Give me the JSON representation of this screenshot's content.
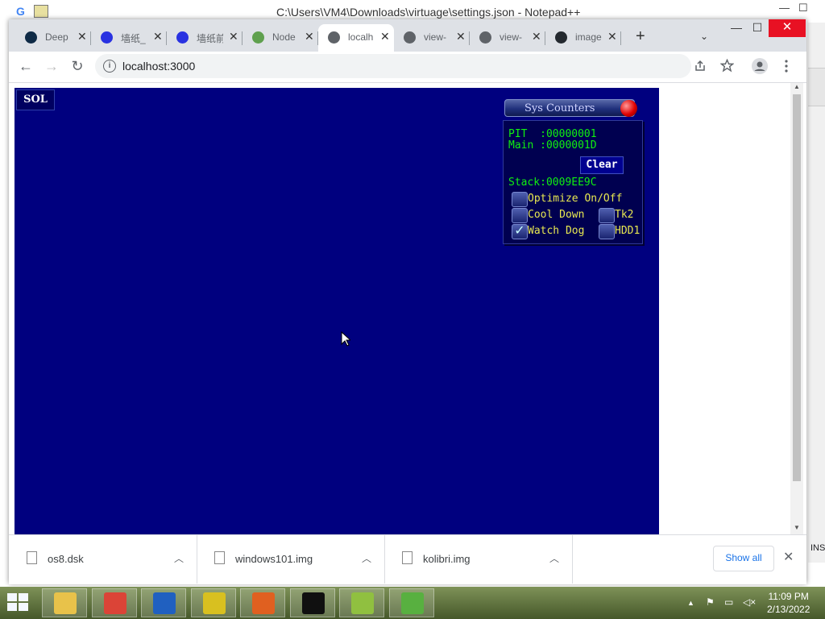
{
  "notepadpp": {
    "title": "C:\\Users\\VM4\\Downloads\\virtuage\\settings.json - Notepad++",
    "minimize": "—",
    "maximize": "☐",
    "ins_status": "INS",
    "g_logo": "G"
  },
  "browser": {
    "tabs": [
      {
        "label": "Deep",
        "icon": "deepl-icon",
        "color": "#0f2b46"
      },
      {
        "label": "墙纸_",
        "icon": "baidu-paw-icon",
        "color": "#2932e1"
      },
      {
        "label": "墙纸前",
        "icon": "baidu-paw-icon",
        "color": "#2932e1"
      },
      {
        "label": "Node",
        "icon": "nodejs-icon",
        "color": "#5fa04e"
      },
      {
        "label": "localh",
        "icon": "globe-icon",
        "color": "#5f6368",
        "active": true
      },
      {
        "label": "view-",
        "icon": "globe-icon",
        "color": "#5f6368"
      },
      {
        "label": "view-",
        "icon": "globe-icon",
        "color": "#5f6368"
      },
      {
        "label": "image",
        "icon": "github-icon",
        "color": "#24292f"
      }
    ],
    "tab_close": "✕",
    "new_tab": "+",
    "tab_search": "⌄",
    "window_min": "—",
    "window_max": "☐",
    "window_close": "✕",
    "nav": {
      "back": "←",
      "forward": "→",
      "reload": "↻"
    },
    "url": "localhost:3000",
    "toolbar_icons": [
      "share-icon",
      "bookmark-star-icon",
      "profile-icon",
      "kebab-menu-icon"
    ]
  },
  "page": {
    "background": "#00007f",
    "sol_button": "SOL",
    "sys_counters": {
      "title": "Sys Counters",
      "pit_line": "PIT  :00000001",
      "main_line": "Main :0000001D",
      "clear": "Clear",
      "stack_line": "Stack:0009EE9C",
      "optimize": "Optimize On/Off",
      "cool_down": "Cool Down",
      "tk2": "Tk2",
      "watch_dog": "Watch Dog",
      "hdd1": "HDD1",
      "checked": {
        "optimize": false,
        "cool_down": false,
        "tk2": false,
        "watch_dog": true,
        "hdd1": false
      }
    }
  },
  "downloads": {
    "items": [
      "os8.dsk",
      "windows101.img",
      "kolibri.img"
    ],
    "show_all": "Show all",
    "close": "✕"
  },
  "taskbar": {
    "apps": [
      {
        "name": "file-explorer-icon",
        "color": "#e8c24a"
      },
      {
        "name": "chrome-icon",
        "color": "#db4437"
      },
      {
        "name": "puppy-icon",
        "color": "#2060c0"
      },
      {
        "name": "yellow-globe-icon",
        "color": "#d8c020"
      },
      {
        "name": "orange-bird-icon",
        "color": "#e06020"
      },
      {
        "name": "cmd-icon",
        "color": "#101010"
      },
      {
        "name": "notepadpp-icon",
        "color": "#90c040"
      },
      {
        "name": "frog-icon",
        "color": "#58b040"
      }
    ],
    "time": "11:09 PM",
    "date": "2/13/2022",
    "tray_up": "▲"
  }
}
